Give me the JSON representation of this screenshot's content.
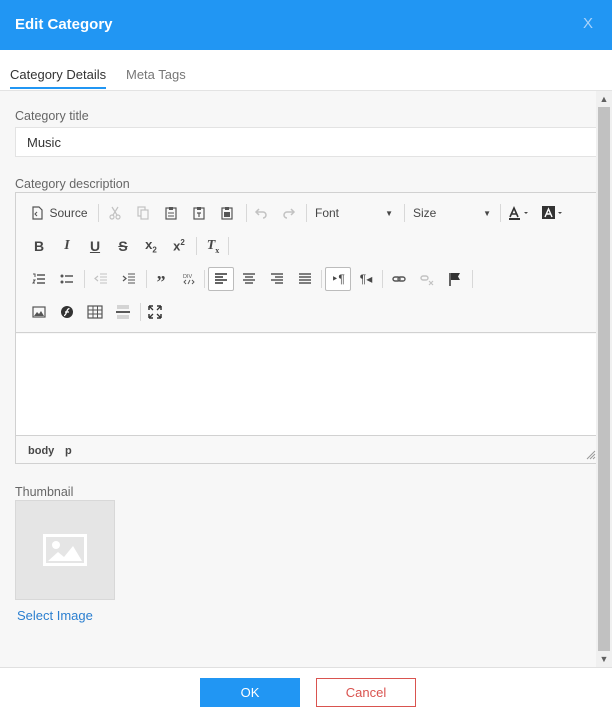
{
  "dialog": {
    "title": "Edit Category",
    "close_label": "X"
  },
  "tabs": [
    {
      "label": "Category Details",
      "active": true
    },
    {
      "label": "Meta Tags",
      "active": false
    }
  ],
  "form": {
    "title_label": "Category title",
    "title_value": "Music",
    "description_label": "Category description",
    "thumbnail_label": "Thumbnail",
    "select_image_label": "Select Image"
  },
  "editor": {
    "source_label": "Source",
    "font_label": "Font",
    "size_label": "Size",
    "path": [
      "body",
      "p"
    ],
    "icons": [
      "source-icon",
      "cut-icon",
      "copy-icon",
      "paste-icon",
      "paste-text-icon",
      "paste-word-icon",
      "undo-icon",
      "redo-icon",
      "text-color-icon",
      "background-color-icon",
      "bold-icon",
      "italic-icon",
      "underline-icon",
      "strikethrough-icon",
      "subscript-icon",
      "superscript-icon",
      "remove-format-icon",
      "numbered-list-icon",
      "bulleted-list-icon",
      "decrease-indent-icon",
      "increase-indent-icon",
      "blockquote-icon",
      "div-container-icon",
      "align-left-icon",
      "align-center-icon",
      "align-right-icon",
      "justify-icon",
      "ltr-icon",
      "rtl-icon",
      "link-icon",
      "unlink-icon",
      "anchor-icon",
      "image-icon",
      "flash-icon",
      "table-icon",
      "horizontal-line-icon",
      "maximize-icon"
    ]
  },
  "footer": {
    "ok_label": "OK",
    "cancel_label": "Cancel"
  },
  "colors": {
    "accent": "#2196f3",
    "danger": "#d9534f",
    "link": "#2b7fd0"
  }
}
